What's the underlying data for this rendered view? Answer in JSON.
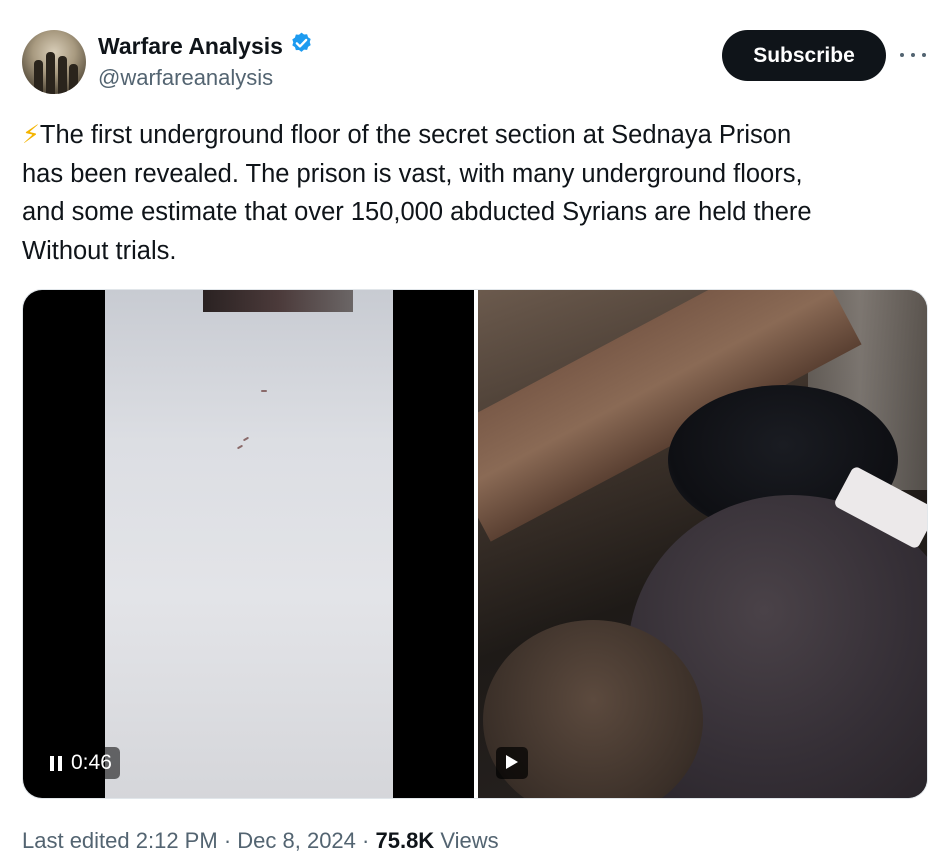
{
  "author": {
    "name": "Warfare Analysis",
    "handle": "@warfareanalysis",
    "verified": true,
    "verified_color": "#1d9bf0"
  },
  "actions": {
    "subscribe_label": "Subscribe",
    "more_icon": "more-horizontal-icon"
  },
  "post": {
    "emoji": "⚡",
    "lines": [
      "The first underground floor of the secret section at Sednaya Prison",
      "has been revealed. The prison is vast, with many underground floors,",
      "and some estimate that over 150,000 abducted Syrians are held there",
      "Without trials."
    ]
  },
  "media": {
    "video_left": {
      "timer": "0:46",
      "state_icon": "pause-icon"
    },
    "video_right": {
      "state_icon": "play-icon"
    }
  },
  "footer": {
    "edited": "Last edited 2:12 PM",
    "separator": "·",
    "date": "Dec 8, 2024",
    "views_count": "75.8K",
    "views_label": "Views"
  },
  "colors": {
    "text_primary": "#0f1419",
    "text_secondary": "#536471",
    "button_bg": "#0f1419"
  }
}
